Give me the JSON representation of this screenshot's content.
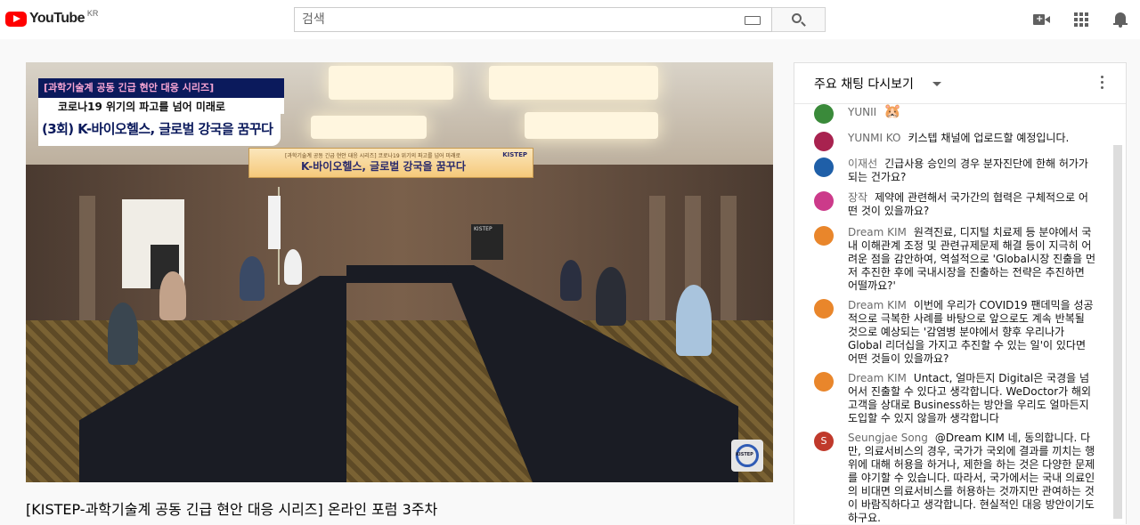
{
  "header": {
    "logo_text": "YouTube",
    "country_code": "KR",
    "search_placeholder": "검색",
    "icons": [
      "keyboard-icon",
      "search-icon",
      "create-video-icon",
      "apps-icon",
      "notifications-icon"
    ]
  },
  "video": {
    "title": "[KISTEP-과학기술계 공동 긴급 현안 대응 시리즈] 온라인 포럼 3주차",
    "overlay_line1": "[과학기술계 공동 긴급 현안 대응 시리즈]",
    "overlay_line2": "코로나19 위기의 파고를 넘어 미래로",
    "overlay_line3": "(3회) K-바이오헬스, 글로벌 강국을 꿈꾸다",
    "banner_sub": "[과학기술계 공동 긴급 현안 대응 시리즈] 코로나19 위기의 파고를 넘어 미래로",
    "banner_main": "K-바이오헬스, 글로벌 강국을 꿈꾸다",
    "banner_org": "KISTEP",
    "podium_label": "KISTEP",
    "corner_logo": "KISTEP"
  },
  "chat": {
    "header_label": "주요 채팅 다시보기",
    "messages": [
      {
        "author": "YUNII",
        "text": "🐹",
        "avatar_color": "#3a8a3a",
        "avatar_letter": ""
      },
      {
        "author": "YUNMI KO",
        "text": "키스텝 채널에 업로드할 예정입니다.",
        "avatar_color": "#a8224f",
        "avatar_letter": ""
      },
      {
        "author": "이재선",
        "text": "긴급사용 승인의 경우 분자진단에 한해 허가가 되는 건가요?",
        "avatar_color": "#1f5fa8",
        "avatar_letter": ""
      },
      {
        "author": "장작",
        "text": "제약에 관련해서 국가간의 협력은 구체적으로 어떤 것이 있을까요?",
        "avatar_color": "#cc3a8a",
        "avatar_letter": ""
      },
      {
        "author": "Dream KIM",
        "text": "원격진료, 디지털 치료제 등 분야에서 국내 이해관계 조정 및 관련규제문제 해결 등이 지극히 어려운 점을 감안하여, 역설적으로 'Global시장 진출을 먼저 추진한 후에 국내시장을 진출하는 전략은 추진하면 어떨까요?'",
        "avatar_color": "#e9862b",
        "avatar_letter": ""
      },
      {
        "author": "Dream KIM",
        "text": "이번에 우리가 COVID19 팬데믹을 성공적으로 극복한 사례를 바탕으로 앞으로도 계속 반복될 것으로 예상되는 '감염병 분야에서 향후 우리나가 Global 리더십을 가지고 추진할 수 있는 일'이 있다면 어떤 것들이 있을까요?",
        "avatar_color": "#e9862b",
        "avatar_letter": ""
      },
      {
        "author": "Dream KIM",
        "text": "Untact, 얼마든지 Digital은 국경을 넘어서 진출할 수 있다고 생각합니다. WeDoctor가 해외고객을 상대로 Business하는 방안을 우리도 얼마든지 도입할 수 있지 않을까 생각합니다",
        "avatar_color": "#e9862b",
        "avatar_letter": ""
      },
      {
        "author": "Seungjae Song",
        "text": "@Dream KIM 네, 동의합니다. 다만, 의료서비스의 경우, 국가가 국외에 결과를 끼치는 행위에 대해 허용을 하거나, 제한을 하는 것은 다양한 문제를 야기할 수 있습니다. 따라서, 국가에서는 국내 의료인의 비대면 의료서비스를 허용하는 것까지만 관여하는 것이 바람직하다고 생각합니다. 현실적인 대응 방안이기도 하구요.",
        "avatar_color": "#c0392b",
        "avatar_letter": "S"
      }
    ]
  }
}
